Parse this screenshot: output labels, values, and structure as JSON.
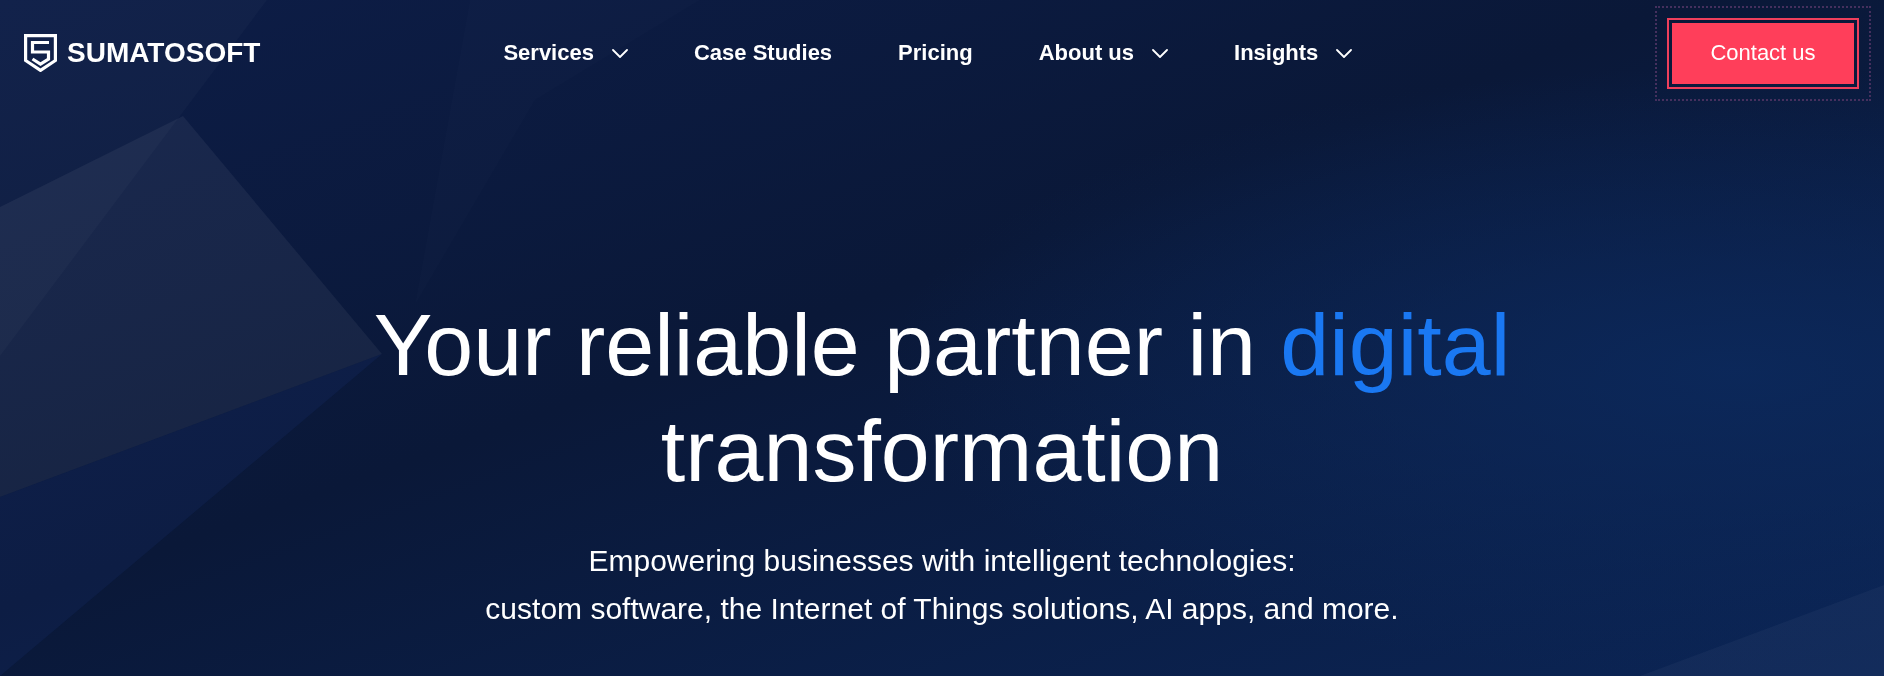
{
  "header": {
    "logo": {
      "text": "SUMATOSOFT"
    },
    "nav": [
      {
        "label": "Services",
        "dropdown": true
      },
      {
        "label": "Case Studies",
        "dropdown": false
      },
      {
        "label": "Pricing",
        "dropdown": false
      },
      {
        "label": "About us",
        "dropdown": true
      },
      {
        "label": "Insights",
        "dropdown": true
      }
    ],
    "cta": {
      "label": "Contact us",
      "focused": true
    }
  },
  "hero": {
    "headline": [
      {
        "text": "Your reliable partner in",
        "accent": false
      },
      {
        "text": "digital",
        "accent": true
      },
      {
        "text": "transformation",
        "accent": false
      }
    ],
    "subtitle": [
      "Empowering businesses with intelligent technologies:",
      "custom software, the Internet of Things solutions, AI apps, and more."
    ]
  }
}
